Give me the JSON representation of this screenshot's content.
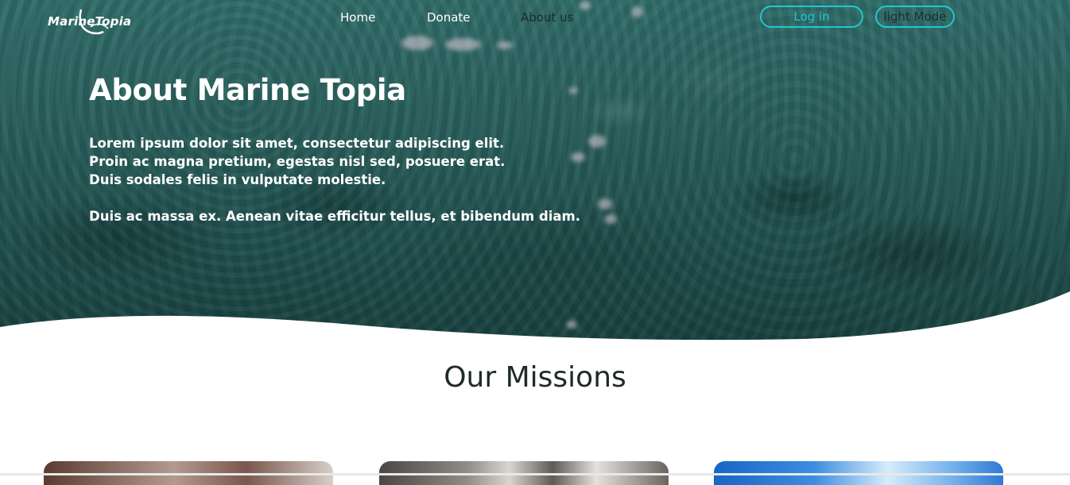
{
  "nav": {
    "logo_text": "MarineTopia",
    "links": [
      "Home",
      "Donate",
      "About us"
    ],
    "login_label": "Log in",
    "mode_label": "light Mode"
  },
  "hero": {
    "title": "About Marine Topia",
    "lines": [
      "Lorem ipsum dolor sit amet, consectetur adipiscing elit.",
      "Proin ac magna pretium, egestas nisl sed, posuere erat.",
      "Duis sodales felis in vulputate molestie."
    ],
    "line4": "Duis ac massa ex. Aenean vitae efficitur tellus, et bibendum diam."
  },
  "missions": {
    "title": "Our Missions"
  },
  "colors": {
    "accent": "#20c8cf",
    "hero_water": "#285e5b"
  }
}
